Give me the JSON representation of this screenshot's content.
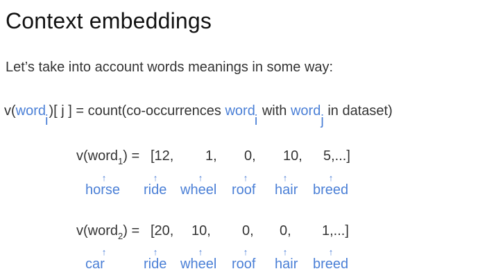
{
  "title": "Context embeddings",
  "intro": "Let’s take into account words meanings in some way:",
  "formula": {
    "prefix": "v(",
    "word1": "word",
    "sub_i": "i",
    "middle": ")[ j ] = count(co-occurrences ",
    "word2": "word",
    "sub_i2": "i",
    "with": " with ",
    "word3": "word",
    "sub_j": "j",
    "suffix": " in dataset)"
  },
  "vector1": {
    "lhs_prefix": "v(word",
    "lhs_sub": "1",
    "lhs_suffix": ") = ",
    "values": [
      "[12,",
      "1,",
      "0,",
      "10,",
      "5,...]"
    ],
    "labels": [
      "horse",
      "ride",
      "wheel",
      "roof",
      "hair",
      "breed"
    ]
  },
  "vector2": {
    "lhs_prefix": "v(word",
    "lhs_sub": "2",
    "lhs_suffix": ") = ",
    "values": [
      "[20,",
      "10,",
      "0,",
      "0,",
      "1,...]"
    ],
    "labels": [
      "car",
      "ride",
      "wheel",
      "roof",
      "hair",
      "breed"
    ]
  },
  "arrow_glyph": "↑",
  "colors": {
    "accent": "#4a7fd6",
    "text": "#333333"
  }
}
